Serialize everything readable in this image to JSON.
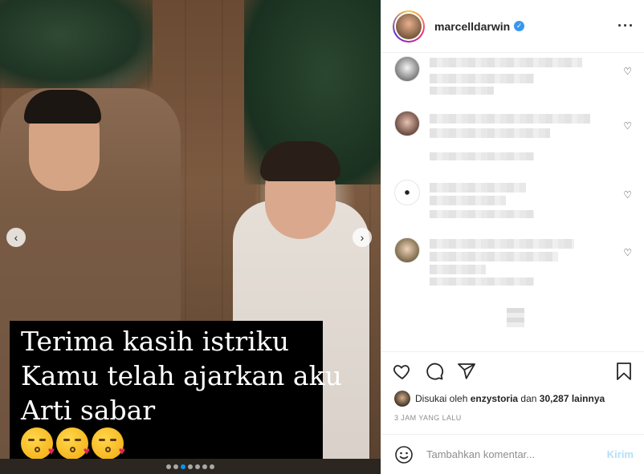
{
  "post": {
    "username": "marcelldarwin",
    "verified": true,
    "more_icon": "more-horizontal-icon"
  },
  "media": {
    "caption_lines": [
      "Terima kasih istriku",
      "Kamu telah ajarkan aku",
      "Arti sabar"
    ],
    "emoji": [
      "face-blowing-a-kiss",
      "face-blowing-a-kiss",
      "face-blowing-a-kiss"
    ],
    "carousel_dots": 7,
    "active_dot": 2,
    "active_dot_color": "#0095f6"
  },
  "actions": {
    "icons": [
      "heart-icon",
      "comment-icon",
      "share-icon",
      "bookmark-icon"
    ]
  },
  "likes": {
    "prefix": "Disukai oleh",
    "user": "enzystoria",
    "mid": "dan",
    "count": "30,287",
    "suffix": "lainnya"
  },
  "timestamp": "3 JAM YANG LALU",
  "comment_box": {
    "placeholder": "Tambahkan komentar...",
    "post_label": "Kirim",
    "post_color": "#b2dffc"
  },
  "colors": {
    "verified": "#3897f0",
    "muted_text": "#8e8e8e"
  }
}
